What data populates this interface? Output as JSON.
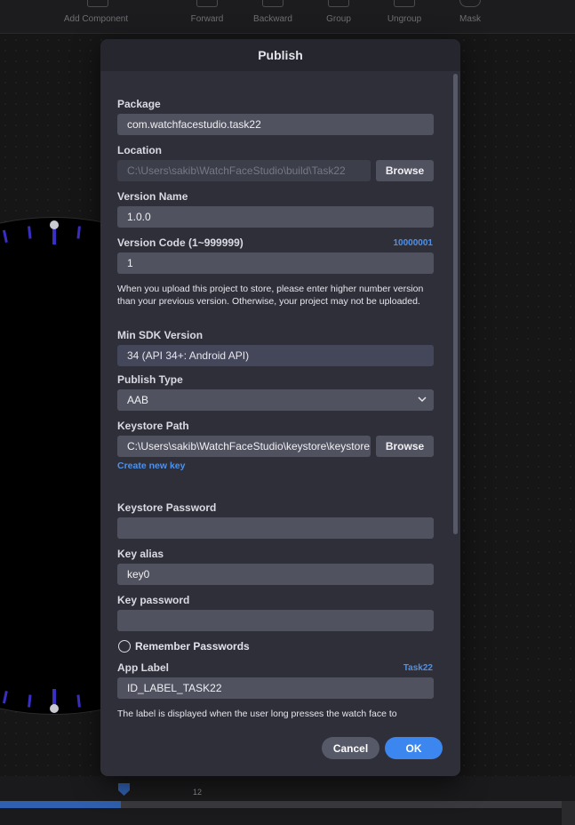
{
  "toolbar": {
    "items": [
      {
        "label": "Add Component",
        "icon": "plus-icon"
      },
      {
        "label": "Forward",
        "icon": "bring-forward-icon"
      },
      {
        "label": "Backward",
        "icon": "send-backward-icon"
      },
      {
        "label": "Group",
        "icon": "group-icon"
      },
      {
        "label": "Ungroup",
        "icon": "ungroup-icon"
      },
      {
        "label": "Mask",
        "icon": "mask-icon"
      }
    ]
  },
  "timeline": {
    "tick_label": "12",
    "progress": 0.215
  },
  "dialog": {
    "title": "Publish",
    "package": {
      "label": "Package",
      "value": "com.watchfacestudio.task22"
    },
    "location": {
      "label": "Location",
      "value": "C:\\Users\\sakib\\WatchFaceStudio\\build\\Task22",
      "browse_label": "Browse"
    },
    "version_name": {
      "label": "Version Name",
      "value": "1.0.0"
    },
    "version_code": {
      "label": "Version Code (1~999999)",
      "hint": "10000001",
      "value": "1"
    },
    "version_note": "When you upload this project to store, please enter higher number version than your previous version. Otherwise, your project may not be uploaded.",
    "min_sdk": {
      "label": "Min SDK Version",
      "value": "34 (API 34+: Android API)"
    },
    "publish_type": {
      "label": "Publish Type",
      "value": "AAB"
    },
    "keystore_path": {
      "label": "Keystore Path",
      "value": "C:\\Users\\sakib\\WatchFaceStudio\\keystore\\keystore.jks",
      "browse_label": "Browse",
      "create_link": "Create new key"
    },
    "keystore_password": {
      "label": "Keystore Password",
      "value": ""
    },
    "key_alias": {
      "label": "Key alias",
      "value": "key0"
    },
    "key_password": {
      "label": "Key password",
      "value": ""
    },
    "remember": {
      "label": "Remember Passwords",
      "checked": false
    },
    "app_label": {
      "label": "App Label",
      "hint": "Task22",
      "value": "ID_LABEL_TASK22"
    },
    "app_label_note": "The label is displayed when the user long presses the watch face to",
    "cancel_label": "Cancel",
    "ok_label": "OK"
  },
  "colors": {
    "accent": "#3c86ef",
    "link": "#4f91ea",
    "dialog_bg": "#2e2f39",
    "field_bg": "#50525f",
    "tick_color": "#3a2fc4"
  }
}
